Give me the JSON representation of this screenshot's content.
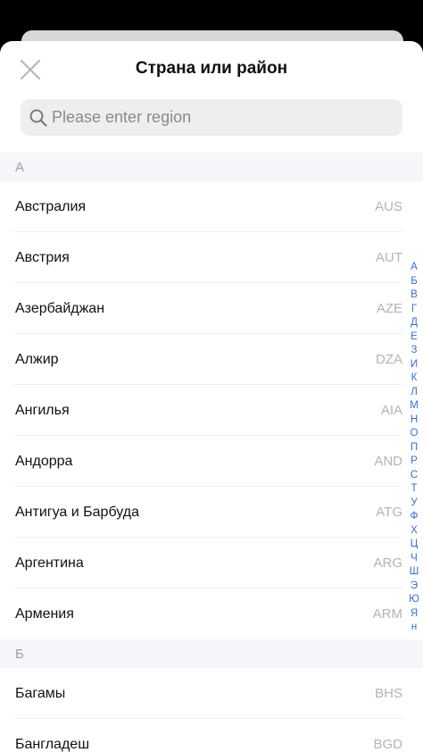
{
  "header": {
    "title": "Страна или район",
    "close_icon": "close-icon"
  },
  "search": {
    "placeholder": "Please enter region",
    "icon": "search-icon"
  },
  "sections": [
    {
      "letter": "А",
      "items": [
        {
          "name": "Австралия",
          "code": "AUS"
        },
        {
          "name": "Австрия",
          "code": "AUT"
        },
        {
          "name": "Азербайджан",
          "code": "AZE"
        },
        {
          "name": "Алжир",
          "code": "DZA"
        },
        {
          "name": "Ангилья",
          "code": "AIA"
        },
        {
          "name": "Андорра",
          "code": "AND"
        },
        {
          "name": "Антигуа и Барбуда",
          "code": "ATG"
        },
        {
          "name": "Аргентина",
          "code": "ARG"
        },
        {
          "name": "Армения",
          "code": "ARM"
        }
      ]
    },
    {
      "letter": "Б",
      "items": [
        {
          "name": "Багамы",
          "code": "BHS"
        },
        {
          "name": "Бангладеш",
          "code": "BGD"
        }
      ]
    }
  ],
  "index": [
    "А",
    "Б",
    "В",
    "Г",
    "Д",
    "Е",
    "З",
    "И",
    "К",
    "Л",
    "М",
    "Н",
    "О",
    "П",
    "Р",
    "С",
    "Т",
    "У",
    "Ф",
    "Х",
    "Ц",
    "Ч",
    "Ш",
    "Э",
    "Ю",
    "Я",
    "н"
  ],
  "colors": {
    "accent": "#2f6fdd",
    "section_bg": "#f4f6f9",
    "code_text": "#b4b4b4"
  }
}
